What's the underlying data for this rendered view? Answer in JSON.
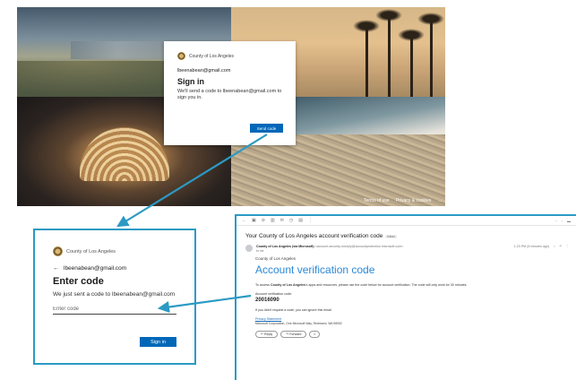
{
  "signin": {
    "org": "County of Los Angeles",
    "email": "lbeenabean@gmail.com",
    "title": "Sign in",
    "desc": "We'll send a code to lbeenabean@gmail.com to sign you in.",
    "button": "Send code",
    "footer_terms": "Terms of use",
    "footer_privacy": "Privacy & cookies",
    "footer_more": "..."
  },
  "code_card": {
    "org": "County of Los Angeles",
    "back_arrow": "←",
    "email": "lbeenabean@gmail.com",
    "title": "Enter code",
    "desc": "We just sent a code to lbeenabean@gmail.com",
    "placeholder": "Enter code",
    "button": "Sign in"
  },
  "email_view": {
    "subject": "Your County of Los Angeles account verification code",
    "tag": "Inbox",
    "sender_name": "County of Los Angeles (via Microsoft)",
    "sender_addr": "<account-security-noreply@accountprotection.microsoft.com>",
    "to": "to me",
    "date": "1:23 PM (5 minutes ago)",
    "org": "County of Los Angeles",
    "heading": "Account verification code",
    "para_pre": "To access ",
    "para_bold": "County of Los Angeles",
    "para_post": "'s apps and resources, please use the code below for account verification. The code will only work for 30 minutes.",
    "code_label": "Account verification code:",
    "code": "20016090",
    "ignore": "If you didn't request a code, you can ignore this email.",
    "privacy": "Privacy Statement",
    "address": "Microsoft Corporation, One Microsoft Way, Redmond, WA 98052",
    "reply": "Reply",
    "forward": "Forward"
  },
  "colors": {
    "accent": "#2b9ac3",
    "primary_button": "#0067b8",
    "heading_blue": "#2b88d8"
  }
}
